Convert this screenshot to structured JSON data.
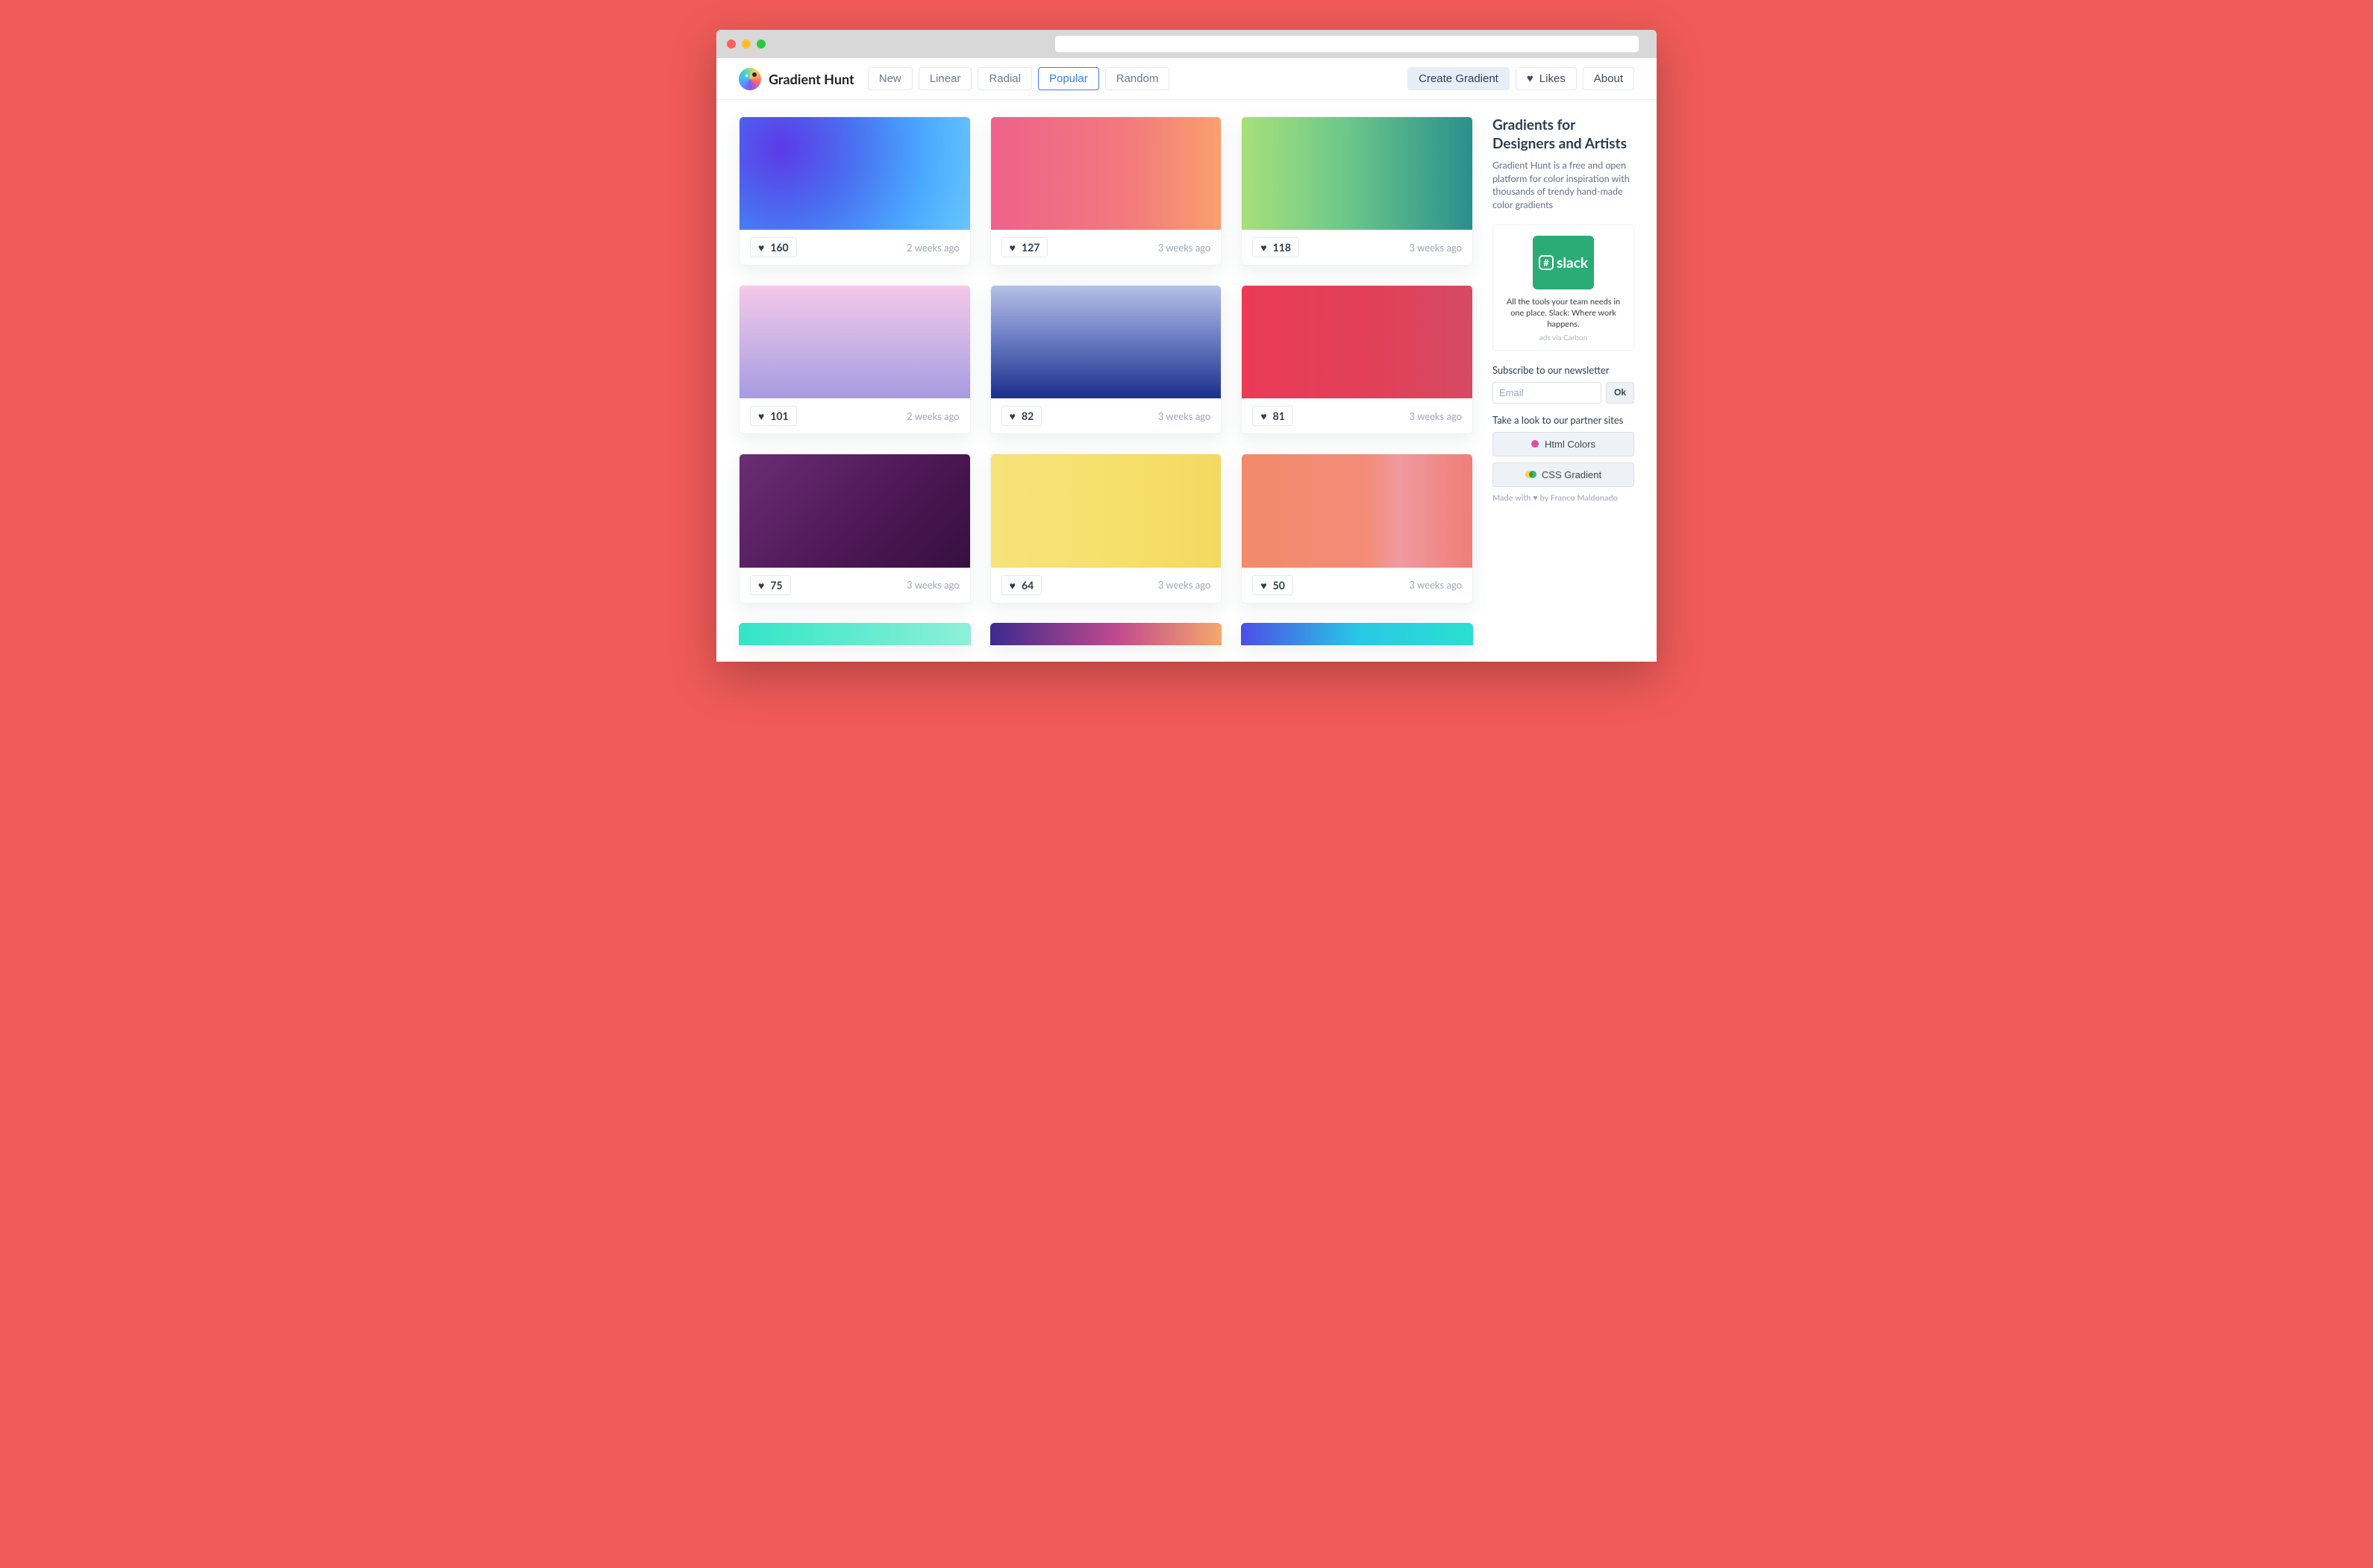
{
  "brand": {
    "title": "Gradient Hunt"
  },
  "nav": {
    "items": [
      "New",
      "Linear",
      "Radial",
      "Popular",
      "Random"
    ],
    "active_index": 3
  },
  "header_actions": {
    "create": "Create Gradient",
    "likes": "Likes",
    "about": "About"
  },
  "gradients": [
    {
      "likes": 160,
      "time": "2 weeks ago",
      "css": "radial-gradient(circle at 18% 28%, #5c3ae8 0%, #4a6ff0 35%, #4aa9ff 70%, #69c6ff 100%)"
    },
    {
      "likes": 127,
      "time": "3 weeks ago",
      "css": "linear-gradient(90deg, #ee628b 0%, #f37a7d 60%, #f9a06e 100%)"
    },
    {
      "likes": 118,
      "time": "3 weeks ago",
      "css": "linear-gradient(90deg, #a8e07a 0%, #6cc88a 45%, #2a8f8d 100%)"
    },
    {
      "likes": 101,
      "time": "2 weeks ago",
      "css": "linear-gradient(180deg, #f4c8e8 0%, #c9b2e6 55%, #a69be0 100%)"
    },
    {
      "likes": 82,
      "time": "3 weeks ago",
      "css": "linear-gradient(180deg, #b5c0e4 0%, #6f7fc6 45%, #1a2f8a 100%)"
    },
    {
      "likes": 81,
      "time": "3 weeks ago",
      "css": "linear-gradient(90deg, #ea3a55 0%, #e04159 60%, #d54a63 100%)"
    },
    {
      "likes": 75,
      "time": "3 weeks ago",
      "css": "linear-gradient(135deg, #6b2d75 0%, #4e1856 55%, #36103f 100%)"
    },
    {
      "likes": 64,
      "time": "3 weeks ago",
      "css": "linear-gradient(90deg, #f7e27c 0%, #f6e06d 50%, #f4d95f 100%)"
    },
    {
      "likes": 50,
      "time": "3 weeks ago",
      "css": "linear-gradient(90deg, #f28b6a 0%, #f38c78 55%, #ef9aa0 68%, #ef7e77 100%)"
    }
  ],
  "peeks": [
    "linear-gradient(90deg, #33e5c7 0%, #8ef0d6 100%)",
    "linear-gradient(90deg, #3b2a8f 0%, #c24a8e 55%, #f5a86b 100%)",
    "linear-gradient(90deg, #4c4ee6 0%, #29c7e6 50%, #2be0d0 100%)"
  ],
  "sidebar": {
    "title": "Gradients for Designers and Artists",
    "desc": "Gradient Hunt is a free and open platform for color inspiration with thousands of trendy hand-made color gradients",
    "ad": {
      "logo_text": "slack",
      "text": "All the tools your team needs in one place. Slack: Where work happens.",
      "via": "ads via Carbon"
    },
    "newsletter_label": "Subscribe to our newsletter",
    "email_placeholder": "Email",
    "ok": "Ok",
    "partners_label": "Take a look to our partner sites",
    "partner1": "Html Colors",
    "partner2": "CSS Gradient",
    "credit_prefix": "Made with ",
    "credit_suffix": " by Franco Maldonado"
  }
}
